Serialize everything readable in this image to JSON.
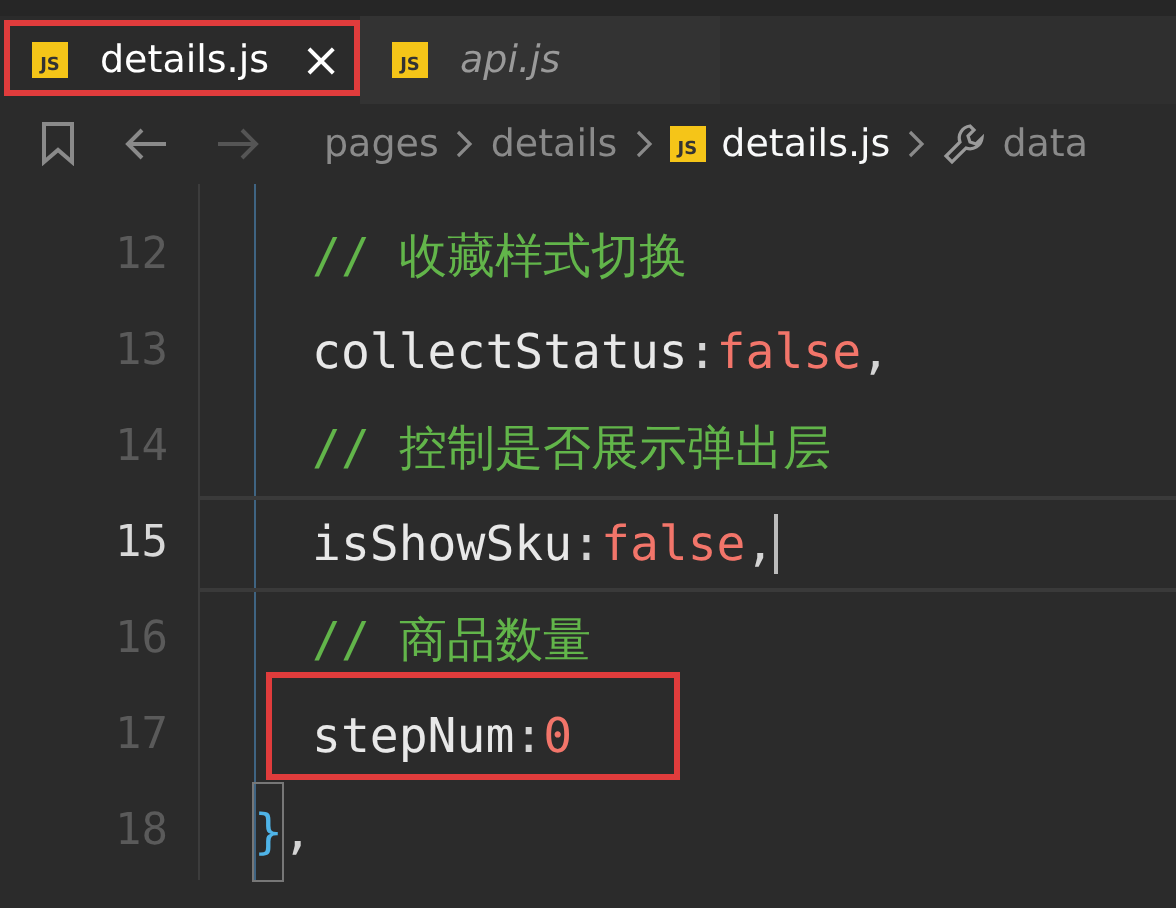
{
  "tabs": [
    {
      "icon": "JS",
      "label": "details.js",
      "selected": true,
      "highlighted": true,
      "close": "×"
    },
    {
      "icon": "JS",
      "label": "api.js",
      "selected": false,
      "highlighted": false
    }
  ],
  "breadcrumb": [
    {
      "kind": "folder",
      "text": "pages"
    },
    {
      "kind": "folder",
      "text": "details"
    },
    {
      "kind": "file",
      "icon": "JS",
      "text": "details.js"
    },
    {
      "kind": "symbol",
      "text": "data"
    }
  ],
  "lines": [
    {
      "number": "12",
      "indented": true,
      "current": false,
      "highlighted": false,
      "tokens": [
        {
          "kind": "comment",
          "text": "// 收藏样式切换"
        }
      ]
    },
    {
      "number": "13",
      "indented": true,
      "current": false,
      "highlighted": false,
      "tokens": [
        {
          "kind": "property",
          "text": "collectStatus"
        },
        {
          "kind": "punct",
          "text": ":"
        },
        {
          "kind": "literal",
          "text": "false"
        },
        {
          "kind": "punct",
          "text": ","
        }
      ]
    },
    {
      "number": "14",
      "indented": true,
      "current": false,
      "highlighted": false,
      "tokens": [
        {
          "kind": "comment",
          "text": "// 控制是否展示弹出层"
        }
      ]
    },
    {
      "number": "15",
      "indented": true,
      "current": true,
      "highlighted": false,
      "tokens": [
        {
          "kind": "property",
          "text": "isShowSku"
        },
        {
          "kind": "punct",
          "text": ":"
        },
        {
          "kind": "literal",
          "text": "false"
        },
        {
          "kind": "punct",
          "text": ","
        }
      ]
    },
    {
      "number": "16",
      "indented": true,
      "current": false,
      "highlighted": false,
      "tokens": [
        {
          "kind": "comment",
          "text": "// 商品数量"
        }
      ]
    },
    {
      "number": "17",
      "indented": true,
      "current": false,
      "highlighted": true,
      "tokens": [
        {
          "kind": "property",
          "text": "stepNum"
        },
        {
          "kind": "punct",
          "text": ":"
        },
        {
          "kind": "literal",
          "text": "0"
        }
      ]
    },
    {
      "number": "18",
      "indented": false,
      "current": false,
      "highlighted": false,
      "tokens": [
        {
          "kind": "bracket",
          "text": "}"
        },
        {
          "kind": "punct",
          "text": ","
        }
      ]
    }
  ]
}
